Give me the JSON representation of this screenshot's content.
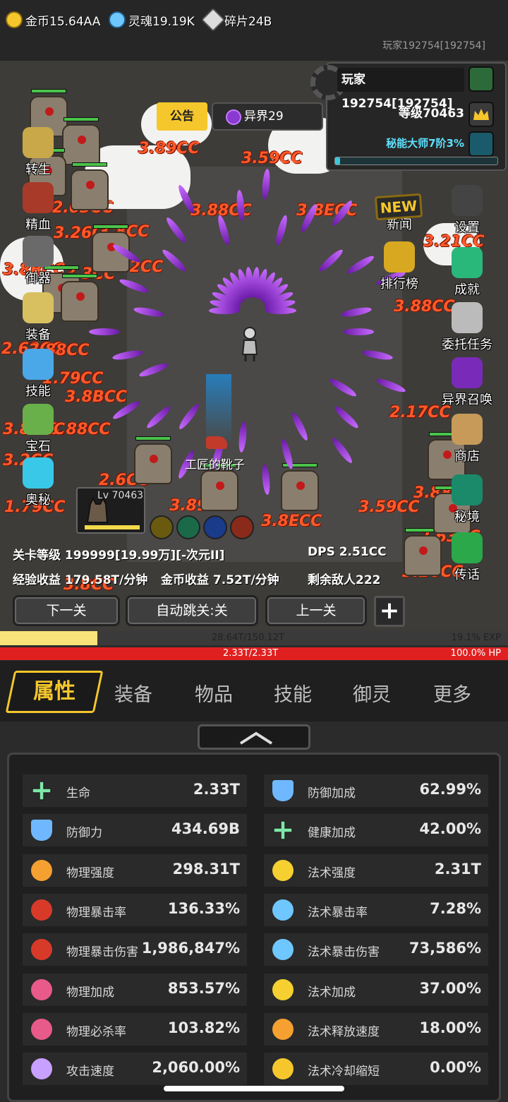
{
  "status_bar": {
    "player_id": "玩家192754[192754]"
  },
  "resources": [
    {
      "label": "金币15.64AA",
      "icon": "gold-coin-icon",
      "color": "#f5c72c"
    },
    {
      "label": "灵魂19.19K",
      "icon": "soul-flame-icon",
      "color": "#6fc7ff"
    },
    {
      "label": "碎片24B",
      "icon": "shard-icon",
      "color": "#dddddd"
    }
  ],
  "player": {
    "name": "玩家192754[192754]",
    "level": "等级70463",
    "rank": "秘能大师7阶3%",
    "rank_progress": 0.03
  },
  "top_buttons": {
    "notice": "公告",
    "otherworld": "异界29"
  },
  "left_menu": [
    "转生",
    "精血",
    "御器",
    "装备",
    "技能",
    "宝石",
    "奥秘"
  ],
  "right_menu": [
    "新闻",
    "设置",
    "排行榜",
    "成就",
    "委托任务",
    "异界召唤",
    "商店",
    "秘境",
    "传话"
  ],
  "news_badge": "NEW",
  "battle": {
    "drop_item": "工匠的靴子",
    "pet_level": "Lv 70463",
    "stage_level": "关卡等级 199999[19.99万][-次元II]",
    "dps": "DPS 2.51CC",
    "exp_income": "经验收益 179.58T/分钟",
    "gold_income": "金币收益 7.52T/分钟",
    "enemies_left": "剩余敌人222",
    "damage_numbers": [
      "3.89CC",
      "3.59CC",
      "3.88CC",
      "3.8ECC",
      "2.63CC",
      "3.26CC",
      "3.8CC",
      "3.21CC",
      "3.3CC",
      "3.8BCC",
      "3.2CC",
      "3.88CC",
      "2.62CC",
      "3.88CC",
      "1.79CC",
      "3.8BCC",
      "2.17CC",
      "3.88CC",
      "3.8BCC",
      "3.2CC",
      "2.6CC",
      "1.79CC"
    ]
  },
  "nav_buttons": {
    "next": "下一关",
    "auto": "自动跳关:关",
    "prev": "上一关"
  },
  "exp_bar": {
    "text": "28.64T/150.12T",
    "percent": "19.1% EXP",
    "fraction": 0.191
  },
  "hp_bar": {
    "text": "2.33T/2.33T",
    "percent": "100.0%  HP",
    "fraction": 1.0
  },
  "tabs": [
    "属性",
    "装备",
    "物品",
    "技能",
    "御灵",
    "更多"
  ],
  "stats_left": [
    {
      "label": "生命",
      "value": "2.33T",
      "icon": "health-cross-icon"
    },
    {
      "label": "防御力",
      "value": "434.69B",
      "icon": "shield-icon"
    },
    {
      "label": "物理强度",
      "value": "298.31T",
      "icon": "physical-power-icon"
    },
    {
      "label": "物理暴击率",
      "value": "136.33%",
      "icon": "physical-crit-icon"
    },
    {
      "label": "物理暴击伤害",
      "value": "1,986,847%",
      "icon": "physical-crit-damage-icon"
    },
    {
      "label": "物理加成",
      "value": "853.57%",
      "icon": "physical-bonus-icon"
    },
    {
      "label": "物理必杀率",
      "value": "103.82%",
      "icon": "physical-deathblow-icon"
    },
    {
      "label": "攻击速度",
      "value": "2,060.00%",
      "icon": "attack-speed-icon"
    }
  ],
  "stats_right": [
    {
      "label": "防御加成",
      "value": "62.99%",
      "icon": "shield-icon"
    },
    {
      "label": "健康加成",
      "value": "42.00%",
      "icon": "health-cross-icon"
    },
    {
      "label": "法术强度",
      "value": "2.31T",
      "icon": "lightning-icon"
    },
    {
      "label": "法术暴击率",
      "value": "7.28%",
      "icon": "ice-flame-icon"
    },
    {
      "label": "法术暴击伤害",
      "value": "73,586%",
      "icon": "ice-flame-icon"
    },
    {
      "label": "法术加成",
      "value": "37.00%",
      "icon": "lightning-icon"
    },
    {
      "label": "法术释放速度",
      "value": "18.00%",
      "icon": "cast-speed-icon"
    },
    {
      "label": "法术冷却缩短",
      "value": "0.00%",
      "icon": "cooldown-icon"
    }
  ],
  "colors": {
    "accent": "#f5c72c",
    "damage": "#ff5a2a",
    "hp": "#e02020",
    "exp": "#f8e37a",
    "rank": "#5ee0ff"
  }
}
